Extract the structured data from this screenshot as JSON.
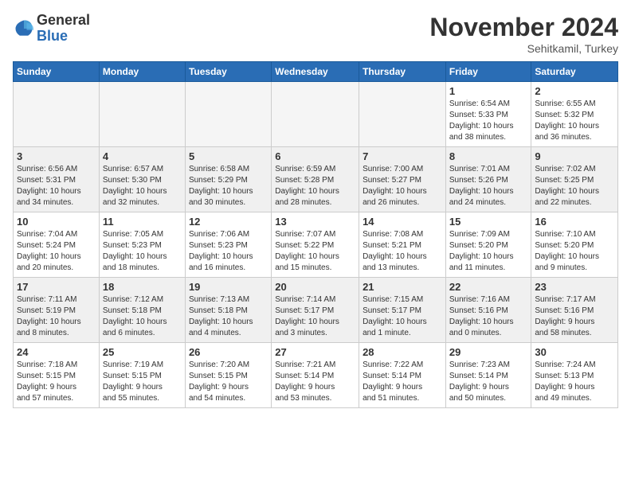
{
  "logo": {
    "general": "General",
    "blue": "Blue"
  },
  "header": {
    "month": "November 2024",
    "location": "Sehitkamil, Turkey"
  },
  "weekdays": [
    "Sunday",
    "Monday",
    "Tuesday",
    "Wednesday",
    "Thursday",
    "Friday",
    "Saturday"
  ],
  "weeks": [
    [
      {
        "day": "",
        "info": ""
      },
      {
        "day": "",
        "info": ""
      },
      {
        "day": "",
        "info": ""
      },
      {
        "day": "",
        "info": ""
      },
      {
        "day": "",
        "info": ""
      },
      {
        "day": "1",
        "info": "Sunrise: 6:54 AM\nSunset: 5:33 PM\nDaylight: 10 hours\nand 38 minutes."
      },
      {
        "day": "2",
        "info": "Sunrise: 6:55 AM\nSunset: 5:32 PM\nDaylight: 10 hours\nand 36 minutes."
      }
    ],
    [
      {
        "day": "3",
        "info": "Sunrise: 6:56 AM\nSunset: 5:31 PM\nDaylight: 10 hours\nand 34 minutes."
      },
      {
        "day": "4",
        "info": "Sunrise: 6:57 AM\nSunset: 5:30 PM\nDaylight: 10 hours\nand 32 minutes."
      },
      {
        "day": "5",
        "info": "Sunrise: 6:58 AM\nSunset: 5:29 PM\nDaylight: 10 hours\nand 30 minutes."
      },
      {
        "day": "6",
        "info": "Sunrise: 6:59 AM\nSunset: 5:28 PM\nDaylight: 10 hours\nand 28 minutes."
      },
      {
        "day": "7",
        "info": "Sunrise: 7:00 AM\nSunset: 5:27 PM\nDaylight: 10 hours\nand 26 minutes."
      },
      {
        "day": "8",
        "info": "Sunrise: 7:01 AM\nSunset: 5:26 PM\nDaylight: 10 hours\nand 24 minutes."
      },
      {
        "day": "9",
        "info": "Sunrise: 7:02 AM\nSunset: 5:25 PM\nDaylight: 10 hours\nand 22 minutes."
      }
    ],
    [
      {
        "day": "10",
        "info": "Sunrise: 7:04 AM\nSunset: 5:24 PM\nDaylight: 10 hours\nand 20 minutes."
      },
      {
        "day": "11",
        "info": "Sunrise: 7:05 AM\nSunset: 5:23 PM\nDaylight: 10 hours\nand 18 minutes."
      },
      {
        "day": "12",
        "info": "Sunrise: 7:06 AM\nSunset: 5:23 PM\nDaylight: 10 hours\nand 16 minutes."
      },
      {
        "day": "13",
        "info": "Sunrise: 7:07 AM\nSunset: 5:22 PM\nDaylight: 10 hours\nand 15 minutes."
      },
      {
        "day": "14",
        "info": "Sunrise: 7:08 AM\nSunset: 5:21 PM\nDaylight: 10 hours\nand 13 minutes."
      },
      {
        "day": "15",
        "info": "Sunrise: 7:09 AM\nSunset: 5:20 PM\nDaylight: 10 hours\nand 11 minutes."
      },
      {
        "day": "16",
        "info": "Sunrise: 7:10 AM\nSunset: 5:20 PM\nDaylight: 10 hours\nand 9 minutes."
      }
    ],
    [
      {
        "day": "17",
        "info": "Sunrise: 7:11 AM\nSunset: 5:19 PM\nDaylight: 10 hours\nand 8 minutes."
      },
      {
        "day": "18",
        "info": "Sunrise: 7:12 AM\nSunset: 5:18 PM\nDaylight: 10 hours\nand 6 minutes."
      },
      {
        "day": "19",
        "info": "Sunrise: 7:13 AM\nSunset: 5:18 PM\nDaylight: 10 hours\nand 4 minutes."
      },
      {
        "day": "20",
        "info": "Sunrise: 7:14 AM\nSunset: 5:17 PM\nDaylight: 10 hours\nand 3 minutes."
      },
      {
        "day": "21",
        "info": "Sunrise: 7:15 AM\nSunset: 5:17 PM\nDaylight: 10 hours\nand 1 minute."
      },
      {
        "day": "22",
        "info": "Sunrise: 7:16 AM\nSunset: 5:16 PM\nDaylight: 10 hours\nand 0 minutes."
      },
      {
        "day": "23",
        "info": "Sunrise: 7:17 AM\nSunset: 5:16 PM\nDaylight: 9 hours\nand 58 minutes."
      }
    ],
    [
      {
        "day": "24",
        "info": "Sunrise: 7:18 AM\nSunset: 5:15 PM\nDaylight: 9 hours\nand 57 minutes."
      },
      {
        "day": "25",
        "info": "Sunrise: 7:19 AM\nSunset: 5:15 PM\nDaylight: 9 hours\nand 55 minutes."
      },
      {
        "day": "26",
        "info": "Sunrise: 7:20 AM\nSunset: 5:15 PM\nDaylight: 9 hours\nand 54 minutes."
      },
      {
        "day": "27",
        "info": "Sunrise: 7:21 AM\nSunset: 5:14 PM\nDaylight: 9 hours\nand 53 minutes."
      },
      {
        "day": "28",
        "info": "Sunrise: 7:22 AM\nSunset: 5:14 PM\nDaylight: 9 hours\nand 51 minutes."
      },
      {
        "day": "29",
        "info": "Sunrise: 7:23 AM\nSunset: 5:14 PM\nDaylight: 9 hours\nand 50 minutes."
      },
      {
        "day": "30",
        "info": "Sunrise: 7:24 AM\nSunset: 5:13 PM\nDaylight: 9 hours\nand 49 minutes."
      }
    ]
  ]
}
